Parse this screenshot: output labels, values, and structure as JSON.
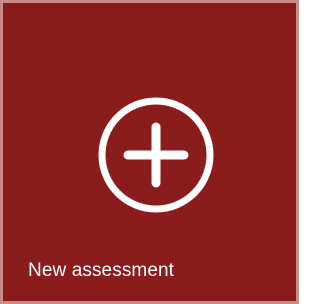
{
  "tile": {
    "label": "New assessment",
    "icon": "plus-circle-icon",
    "background_color": "#8b1c1c",
    "border_color": "#c98a8a"
  }
}
